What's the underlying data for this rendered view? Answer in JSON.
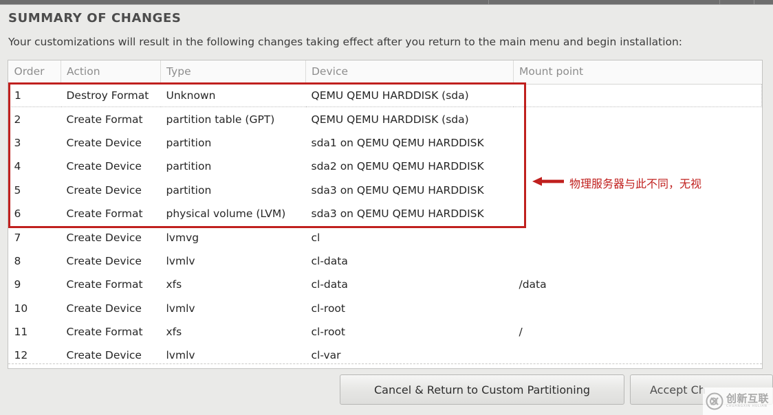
{
  "window": {
    "title": "SUMMARY OF CHANGES",
    "subtitle": "Your customizations will result in the following changes taking effect after you return to the main menu and begin installation:"
  },
  "table": {
    "headers": {
      "order": "Order",
      "action": "Action",
      "type": "Type",
      "device": "Device",
      "mount_point": "Mount point"
    },
    "rows": [
      {
        "order": "1",
        "action": "Destroy Format",
        "action_kind": "destroy",
        "type": "Unknown",
        "device": "QEMU QEMU HARDDISK (sda)",
        "mount": ""
      },
      {
        "order": "2",
        "action": "Create Format",
        "action_kind": "create",
        "type": "partition table (GPT)",
        "device": "QEMU QEMU HARDDISK (sda)",
        "mount": ""
      },
      {
        "order": "3",
        "action": "Create Device",
        "action_kind": "create",
        "type": "partition",
        "device": "sda1 on QEMU QEMU HARDDISK",
        "mount": ""
      },
      {
        "order": "4",
        "action": "Create Device",
        "action_kind": "create",
        "type": "partition",
        "device": "sda2 on QEMU QEMU HARDDISK",
        "mount": ""
      },
      {
        "order": "5",
        "action": "Create Device",
        "action_kind": "create",
        "type": "partition",
        "device": "sda3 on QEMU QEMU HARDDISK",
        "mount": ""
      },
      {
        "order": "6",
        "action": "Create Format",
        "action_kind": "create",
        "type": "physical volume (LVM)",
        "device": "sda3 on QEMU QEMU HARDDISK",
        "mount": ""
      },
      {
        "order": "7",
        "action": "Create Device",
        "action_kind": "create",
        "type": "lvmvg",
        "device": "cl",
        "mount": ""
      },
      {
        "order": "8",
        "action": "Create Device",
        "action_kind": "create",
        "type": "lvmlv",
        "device": "cl-data",
        "mount": ""
      },
      {
        "order": "9",
        "action": "Create Format",
        "action_kind": "create",
        "type": "xfs",
        "device": "cl-data",
        "mount": "/data"
      },
      {
        "order": "10",
        "action": "Create Device",
        "action_kind": "create",
        "type": "lvmlv",
        "device": "cl-root",
        "mount": ""
      },
      {
        "order": "11",
        "action": "Create Format",
        "action_kind": "create",
        "type": "xfs",
        "device": "cl-root",
        "mount": "/"
      },
      {
        "order": "12",
        "action": "Create Device",
        "action_kind": "create",
        "type": "lvmlv",
        "device": "cl-var",
        "mount": ""
      }
    ]
  },
  "annotation": {
    "text": "物理服务器与此不同，无视",
    "color": "#c0201e",
    "arrow_icon": "left-arrow-icon",
    "box_icon": "highlight-box"
  },
  "footer": {
    "cancel_label": "Cancel & Return to Custom Partitioning",
    "accept_label": "Accept Ch"
  },
  "watermark": {
    "cn": "创新互联",
    "en": "CHUANGXIN HULIAN",
    "logo_icon": "cx-logo-icon"
  },
  "colors": {
    "destroy": "#e35d5b",
    "create": "#4aa44e",
    "annotation": "#c0201e",
    "background": "#eaeae8",
    "header_text": "#8d8d8d"
  }
}
